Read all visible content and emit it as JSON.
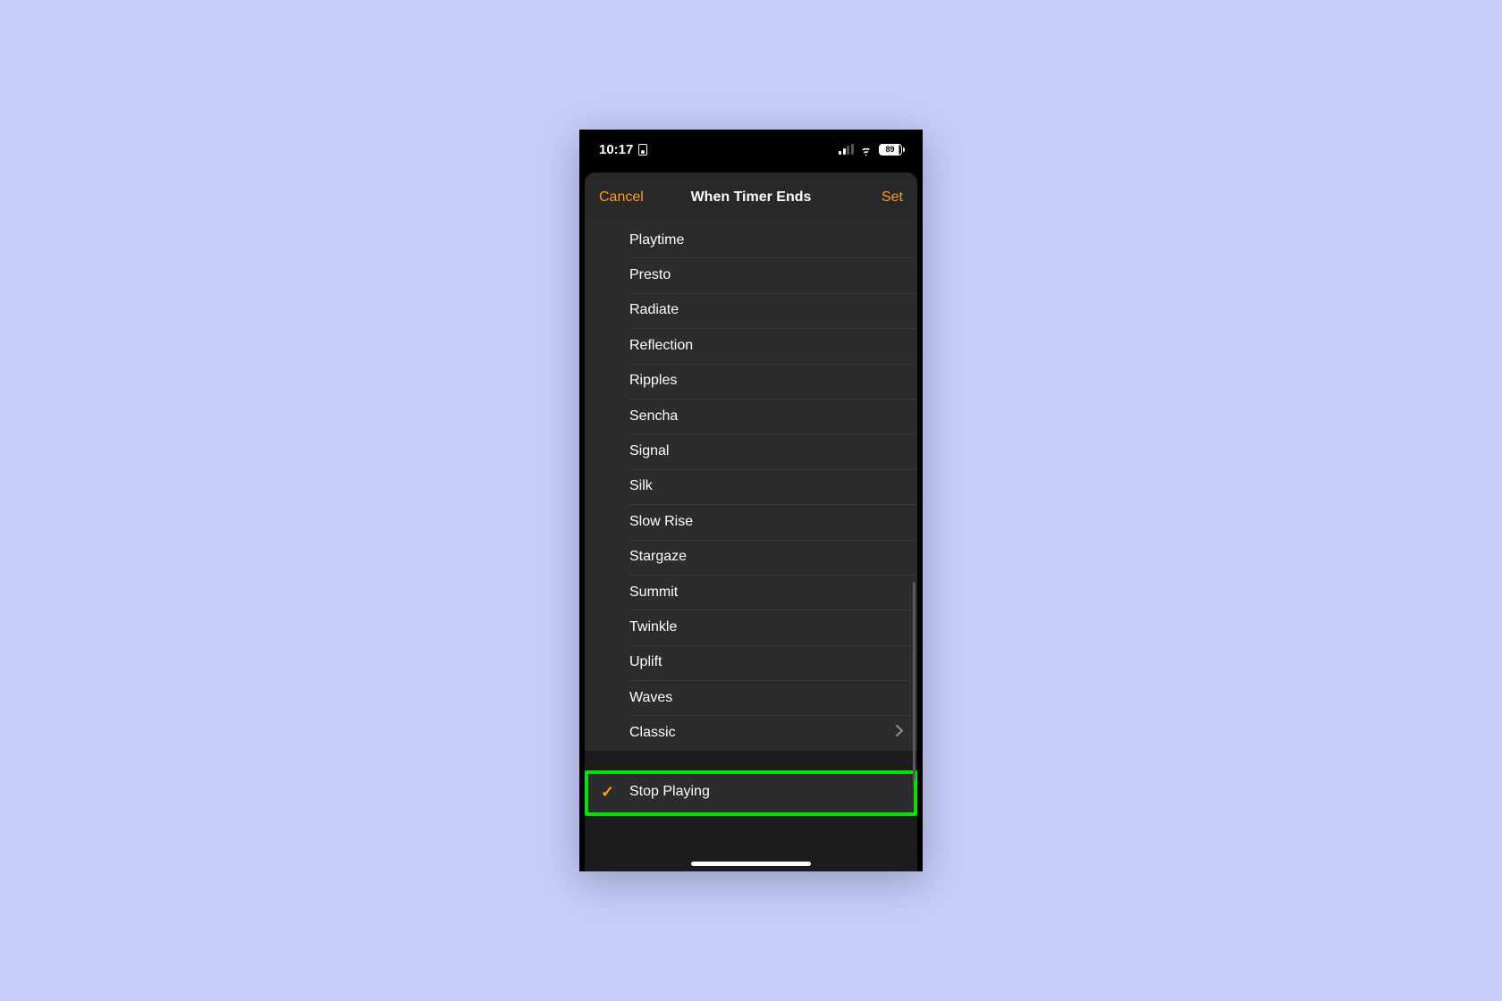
{
  "status": {
    "time": "10:17",
    "battery_pct": "89"
  },
  "nav": {
    "cancel": "Cancel",
    "title": "When Timer Ends",
    "set": "Set"
  },
  "sounds": [
    "Playtime",
    "Presto",
    "Radiate",
    "Reflection",
    "Ripples",
    "Sencha",
    "Signal",
    "Silk",
    "Slow Rise",
    "Stargaze",
    "Summit",
    "Twinkle",
    "Uplift",
    "Waves",
    "Classic"
  ],
  "stop_playing": {
    "label": "Stop Playing",
    "selected": true
  },
  "colors": {
    "accent": "#ff9f0a",
    "highlight": "#00e402"
  }
}
